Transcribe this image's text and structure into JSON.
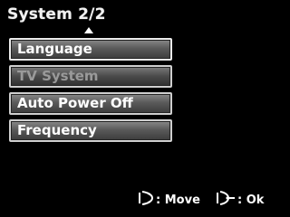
{
  "header": {
    "title": "System 2/2"
  },
  "menu": {
    "items": [
      {
        "label": "Language",
        "state": "normal"
      },
      {
        "label": "TV System",
        "state": "disabled"
      },
      {
        "label": "Auto Power Off",
        "state": "normal"
      },
      {
        "label": "Frequency",
        "state": "normal"
      }
    ]
  },
  "footer": {
    "move_label": ": Move",
    "ok_label": ": Ok",
    "move_icon": "dpad-updown-icon",
    "ok_icon": "dpad-left-ok-icon"
  },
  "colors": {
    "background": "#000000",
    "item_border": "#cfcfcf",
    "item_fill_top": "#8a8a8a",
    "item_fill_bottom": "#3c3c3c",
    "disabled_text": "#9a9a9a"
  }
}
